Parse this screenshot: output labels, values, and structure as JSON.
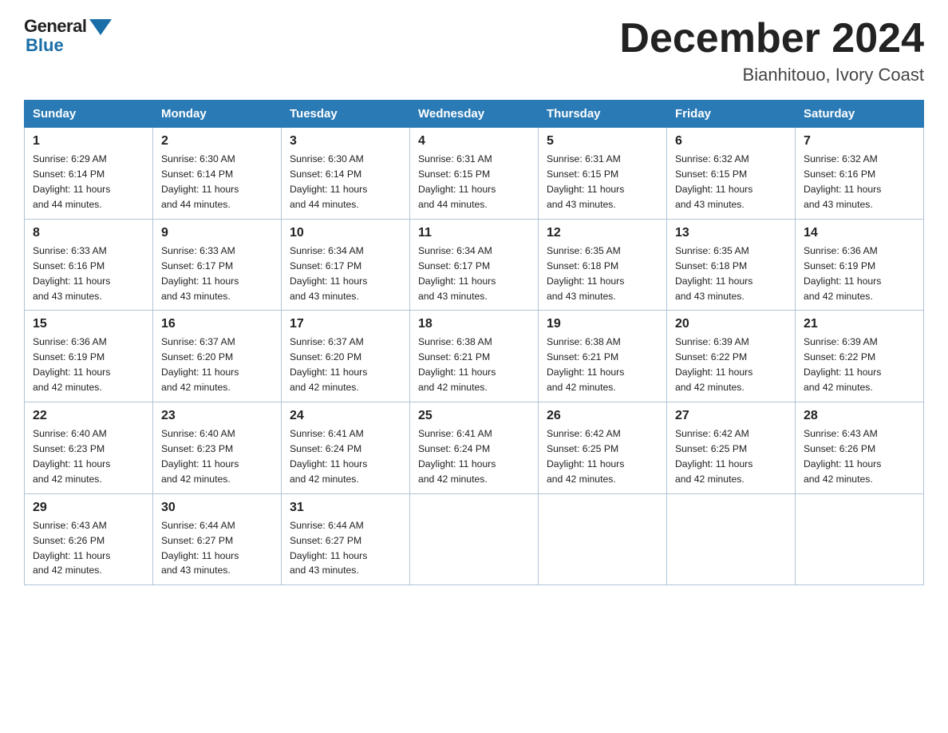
{
  "logo": {
    "general": "General",
    "blue": "Blue"
  },
  "title": "December 2024",
  "location": "Bianhitouo, Ivory Coast",
  "days_of_week": [
    "Sunday",
    "Monday",
    "Tuesday",
    "Wednesday",
    "Thursday",
    "Friday",
    "Saturday"
  ],
  "weeks": [
    [
      {
        "num": "1",
        "sunrise": "6:29 AM",
        "sunset": "6:14 PM",
        "daylight": "11 hours and 44 minutes."
      },
      {
        "num": "2",
        "sunrise": "6:30 AM",
        "sunset": "6:14 PM",
        "daylight": "11 hours and 44 minutes."
      },
      {
        "num": "3",
        "sunrise": "6:30 AM",
        "sunset": "6:14 PM",
        "daylight": "11 hours and 44 minutes."
      },
      {
        "num": "4",
        "sunrise": "6:31 AM",
        "sunset": "6:15 PM",
        "daylight": "11 hours and 44 minutes."
      },
      {
        "num": "5",
        "sunrise": "6:31 AM",
        "sunset": "6:15 PM",
        "daylight": "11 hours and 43 minutes."
      },
      {
        "num": "6",
        "sunrise": "6:32 AM",
        "sunset": "6:15 PM",
        "daylight": "11 hours and 43 minutes."
      },
      {
        "num": "7",
        "sunrise": "6:32 AM",
        "sunset": "6:16 PM",
        "daylight": "11 hours and 43 minutes."
      }
    ],
    [
      {
        "num": "8",
        "sunrise": "6:33 AM",
        "sunset": "6:16 PM",
        "daylight": "11 hours and 43 minutes."
      },
      {
        "num": "9",
        "sunrise": "6:33 AM",
        "sunset": "6:17 PM",
        "daylight": "11 hours and 43 minutes."
      },
      {
        "num": "10",
        "sunrise": "6:34 AM",
        "sunset": "6:17 PM",
        "daylight": "11 hours and 43 minutes."
      },
      {
        "num": "11",
        "sunrise": "6:34 AM",
        "sunset": "6:17 PM",
        "daylight": "11 hours and 43 minutes."
      },
      {
        "num": "12",
        "sunrise": "6:35 AM",
        "sunset": "6:18 PM",
        "daylight": "11 hours and 43 minutes."
      },
      {
        "num": "13",
        "sunrise": "6:35 AM",
        "sunset": "6:18 PM",
        "daylight": "11 hours and 43 minutes."
      },
      {
        "num": "14",
        "sunrise": "6:36 AM",
        "sunset": "6:19 PM",
        "daylight": "11 hours and 42 minutes."
      }
    ],
    [
      {
        "num": "15",
        "sunrise": "6:36 AM",
        "sunset": "6:19 PM",
        "daylight": "11 hours and 42 minutes."
      },
      {
        "num": "16",
        "sunrise": "6:37 AM",
        "sunset": "6:20 PM",
        "daylight": "11 hours and 42 minutes."
      },
      {
        "num": "17",
        "sunrise": "6:37 AM",
        "sunset": "6:20 PM",
        "daylight": "11 hours and 42 minutes."
      },
      {
        "num": "18",
        "sunrise": "6:38 AM",
        "sunset": "6:21 PM",
        "daylight": "11 hours and 42 minutes."
      },
      {
        "num": "19",
        "sunrise": "6:38 AM",
        "sunset": "6:21 PM",
        "daylight": "11 hours and 42 minutes."
      },
      {
        "num": "20",
        "sunrise": "6:39 AM",
        "sunset": "6:22 PM",
        "daylight": "11 hours and 42 minutes."
      },
      {
        "num": "21",
        "sunrise": "6:39 AM",
        "sunset": "6:22 PM",
        "daylight": "11 hours and 42 minutes."
      }
    ],
    [
      {
        "num": "22",
        "sunrise": "6:40 AM",
        "sunset": "6:23 PM",
        "daylight": "11 hours and 42 minutes."
      },
      {
        "num": "23",
        "sunrise": "6:40 AM",
        "sunset": "6:23 PM",
        "daylight": "11 hours and 42 minutes."
      },
      {
        "num": "24",
        "sunrise": "6:41 AM",
        "sunset": "6:24 PM",
        "daylight": "11 hours and 42 minutes."
      },
      {
        "num": "25",
        "sunrise": "6:41 AM",
        "sunset": "6:24 PM",
        "daylight": "11 hours and 42 minutes."
      },
      {
        "num": "26",
        "sunrise": "6:42 AM",
        "sunset": "6:25 PM",
        "daylight": "11 hours and 42 minutes."
      },
      {
        "num": "27",
        "sunrise": "6:42 AM",
        "sunset": "6:25 PM",
        "daylight": "11 hours and 42 minutes."
      },
      {
        "num": "28",
        "sunrise": "6:43 AM",
        "sunset": "6:26 PM",
        "daylight": "11 hours and 42 minutes."
      }
    ],
    [
      {
        "num": "29",
        "sunrise": "6:43 AM",
        "sunset": "6:26 PM",
        "daylight": "11 hours and 42 minutes."
      },
      {
        "num": "30",
        "sunrise": "6:44 AM",
        "sunset": "6:27 PM",
        "daylight": "11 hours and 43 minutes."
      },
      {
        "num": "31",
        "sunrise": "6:44 AM",
        "sunset": "6:27 PM",
        "daylight": "11 hours and 43 minutes."
      },
      null,
      null,
      null,
      null
    ]
  ]
}
